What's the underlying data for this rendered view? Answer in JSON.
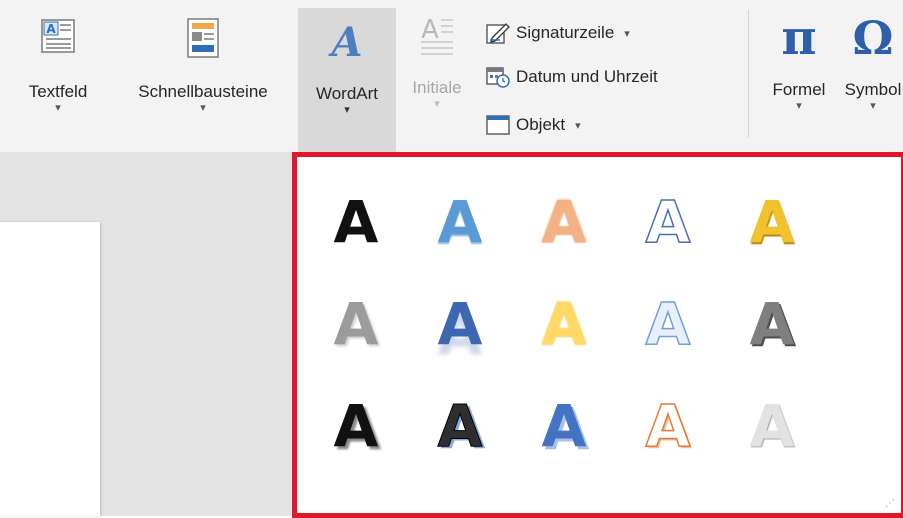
{
  "ribbon": {
    "textfeld": "Textfeld",
    "schnellbausteine": "Schnellbausteine",
    "wordart": "WordArt",
    "initiale": "Initiale",
    "signaturzeile": "Signaturzeile",
    "datum_uhrzeit": "Datum und Uhrzeit",
    "objekt": "Objekt",
    "formel": "Formel",
    "symbol": "Symbol",
    "dropdown_glyph": "▾"
  },
  "gallery": {
    "sample_letter": "A",
    "styles": [
      "black-plain",
      "blue-gradient",
      "orange-soft",
      "outline-white",
      "gold-gradient",
      "gray-shadow",
      "blue-reflection",
      "yellow-soft",
      "outline-blue",
      "gray-bevel",
      "black-shadow",
      "dark-outline",
      "blue-3d",
      "orange-outline",
      "silver-soft"
    ]
  }
}
